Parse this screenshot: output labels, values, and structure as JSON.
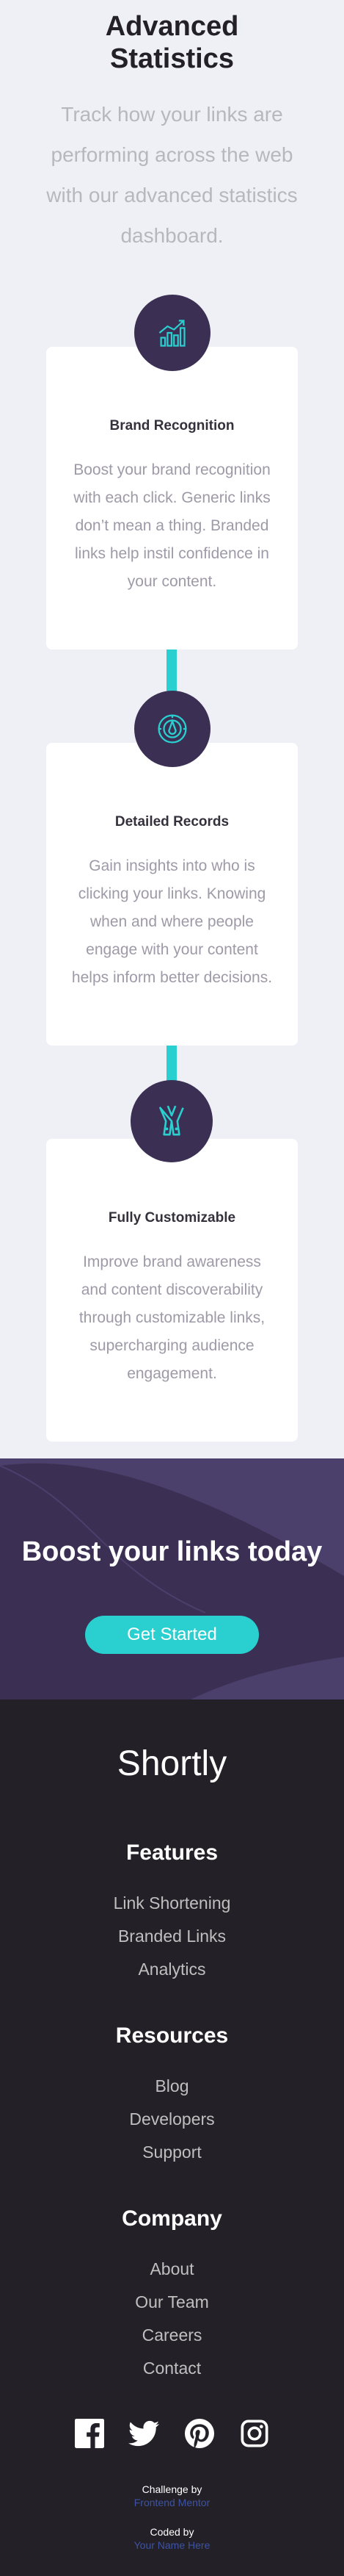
{
  "stats": {
    "title": "Advanced Statistics",
    "subtitle": "Track how your links are performing across the web with our advanced statistics dashboard.",
    "cards": [
      {
        "icon": "brand-recognition-icon",
        "title": "Brand Recognition",
        "description": "Boost your brand recognition with each click. Generic links don’t mean a thing. Branded links help instil confidence in your content."
      },
      {
        "icon": "detailed-records-icon",
        "title": "Detailed Records",
        "description": "Gain insights into who is clicking your links. Knowing when and where people engage with your content helps inform better decisions."
      },
      {
        "icon": "fully-customizable-icon",
        "title": "Fully Customizable",
        "description": "Improve brand awareness and content discoverability through customizable links, supercharging audience engagement."
      }
    ]
  },
  "boost": {
    "title": "Boost your links today",
    "button_label": "Get Started"
  },
  "footer": {
    "logo": "Shortly",
    "columns": [
      {
        "heading": "Features",
        "links": [
          "Link Shortening",
          "Branded Links",
          "Analytics"
        ]
      },
      {
        "heading": "Resources",
        "links": [
          "Blog",
          "Developers",
          "Support"
        ]
      },
      {
        "heading": "Company",
        "links": [
          "About",
          "Our Team",
          "Careers",
          "Contact"
        ]
      }
    ],
    "social_icons": [
      "facebook-icon",
      "twitter-icon",
      "pinterest-icon",
      "instagram-icon"
    ],
    "attribution": {
      "challenge_label": "Challenge by",
      "challenge_link": "Frontend Mentor",
      "coded_label": "Coded by",
      "coded_link": "Your Name Here"
    }
  },
  "colors": {
    "cyan": "#2acfcf",
    "dark_violet": "#3b3054",
    "very_dark_violet": "#232127",
    "background": "#eff0f5",
    "gray_text": "#9e9aa7",
    "attribution_link": "#3e52a3"
  }
}
